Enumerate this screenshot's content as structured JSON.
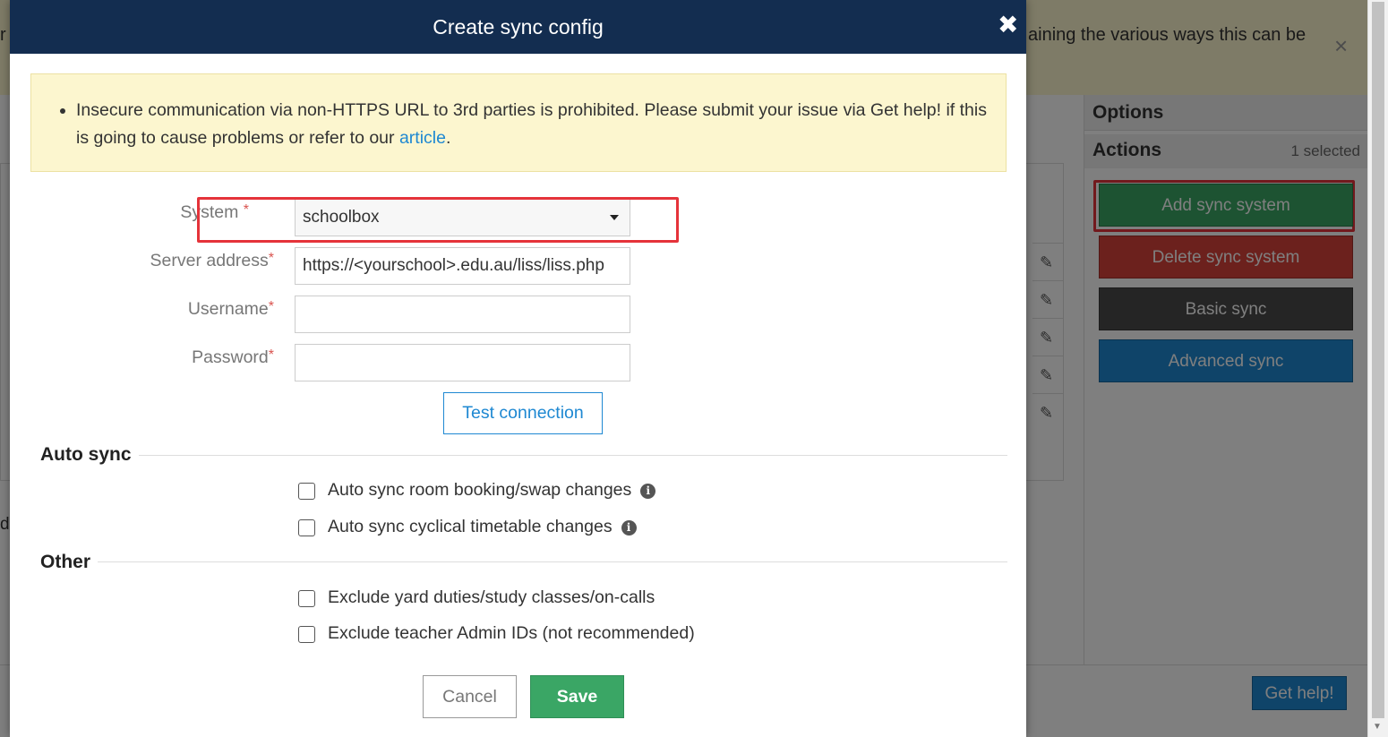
{
  "background": {
    "banner_text": "aining the various ways this can be",
    "banner_left_text": "r",
    "banner_close": "×",
    "sidebar": {
      "options_label": "Options",
      "actions_label": "Actions",
      "selected_count": "1 selected",
      "buttons": [
        {
          "label": "Add sync system",
          "color": "#3aa665"
        },
        {
          "label": "Delete sync system",
          "color": "#d9423a"
        },
        {
          "label": "Basic sync",
          "color": "#4a4a4a"
        },
        {
          "label": "Advanced sync",
          "color": "#1e88d2"
        }
      ]
    },
    "get_help_label": "Get help!",
    "left_edge_text": "d"
  },
  "modal": {
    "title": "Create sync config",
    "close_glyph": "✖",
    "alert": {
      "text_before": "Insecure communication via non-HTTPS URL to 3rd parties is prohibited. Please submit your issue via Get help! if this is going to cause problems or refer to our ",
      "link_text": "article",
      "text_after": "."
    },
    "form": {
      "system_label": "System",
      "system_value": "schoolbox",
      "server_label": "Server address",
      "server_value": "https://<yourschool>.edu.au/liss/liss.php",
      "username_label": "Username",
      "username_value": "",
      "password_label": "Password",
      "password_value": "",
      "required_marker": "*",
      "test_connection_label": "Test connection"
    },
    "auto_sync": {
      "title": "Auto sync",
      "options": [
        {
          "label": "Auto sync room booking/swap changes",
          "checked": false,
          "has_info": true
        },
        {
          "label": "Auto sync cyclical timetable changes",
          "checked": false,
          "has_info": true
        }
      ]
    },
    "other": {
      "title": "Other",
      "options": [
        {
          "label": "Exclude yard duties/study classes/on-calls",
          "checked": false
        },
        {
          "label": "Exclude teacher Admin IDs (not recommended)",
          "checked": false
        }
      ]
    },
    "cancel_label": "Cancel",
    "save_label": "Save"
  }
}
